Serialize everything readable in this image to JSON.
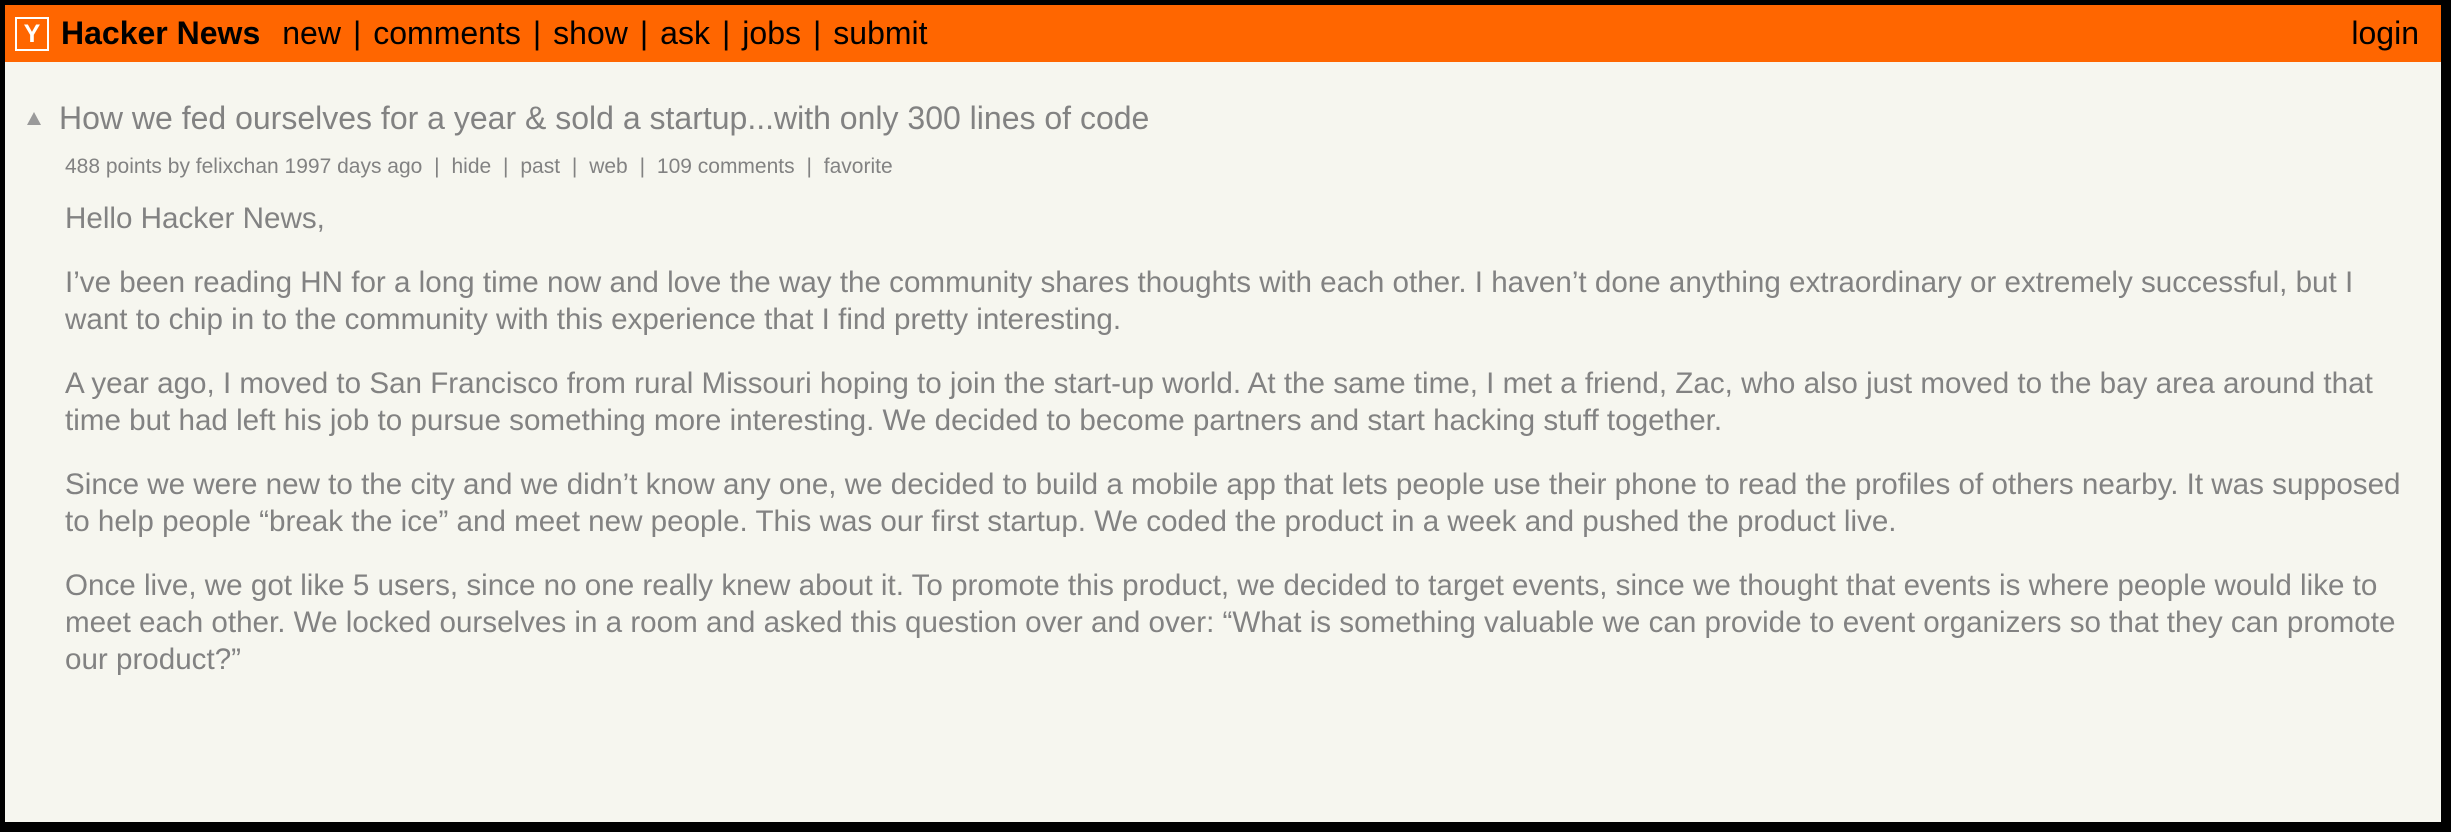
{
  "header": {
    "logo": "Y",
    "site_name": "Hacker News",
    "nav": [
      "new",
      "comments",
      "show",
      "ask",
      "jobs",
      "submit"
    ],
    "separator": "|",
    "login": "login",
    "bar_color": "#ff6600"
  },
  "story": {
    "title": "How we fed ourselves for a year & sold a startup...with only 300 lines of code",
    "subtext": {
      "points": "488 points",
      "by": "by",
      "user": "felixchan",
      "age": "1997 days ago",
      "hide": "hide",
      "past": "past",
      "web": "web",
      "comments": "109 comments",
      "favorite": "favorite"
    },
    "paragraphs": [
      "Hello Hacker News,",
      "I’ve been reading HN for a long time now and love the way the community shares thoughts with each other. I haven’t done anything extraordinary or extremely successful, but I want to chip in to the community with this experience that I find pretty interesting.",
      "A year ago, I moved to San Francisco from rural Missouri hoping to join the start-up world. At the same time, I met a friend, Zac, who also just moved to the bay area around that time but had left his job to pursue something more interesting. We decided to become partners and start hacking stuff together.",
      "Since we were new to the city and we didn’t know any one, we decided to build a mobile app that lets people use their phone to read the profiles of others nearby. It was supposed to help people “break the ice” and meet new people. This was our first startup. We coded the product in a week and pushed the product live.",
      "Once live, we got like 5 users, since no one really knew about it. To promote this product, we decided to target events, since we thought that events is where people would like to meet each other. We locked ourselves in a room and asked this question over and over: “What is something valuable we can provide to event organizers so that they can promote our product?”"
    ]
  },
  "colors": {
    "background": "#f6f6ef",
    "text_gray": "#828282"
  }
}
